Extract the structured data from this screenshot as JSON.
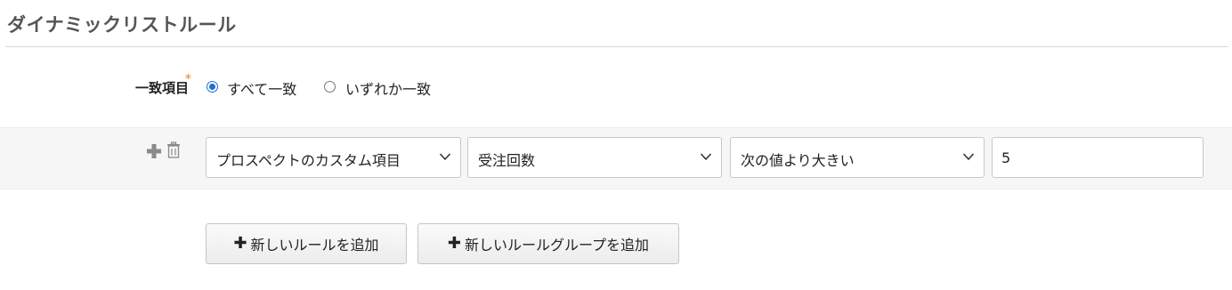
{
  "section": {
    "title": "ダイナミックリストルール"
  },
  "match": {
    "label": "一致項目",
    "required_mark": "*",
    "options": [
      {
        "label": "すべて一致",
        "checked": true
      },
      {
        "label": "いずれか一致",
        "checked": false
      }
    ]
  },
  "rule": {
    "icons": [
      "plus-icon",
      "trash-icon"
    ],
    "field_type": "プロスペクトのカスタム項目",
    "field": "受注回数",
    "operator": "次の値より大きい",
    "value": "5"
  },
  "buttons": {
    "add_rule": "新しいルールを追加",
    "add_rule_group": "新しいルールグループを追加",
    "plus_glyph": "✚"
  },
  "colors": {
    "accent": "#1f6fd1",
    "required": "#e8a33d",
    "band": "#f6f6f6"
  }
}
